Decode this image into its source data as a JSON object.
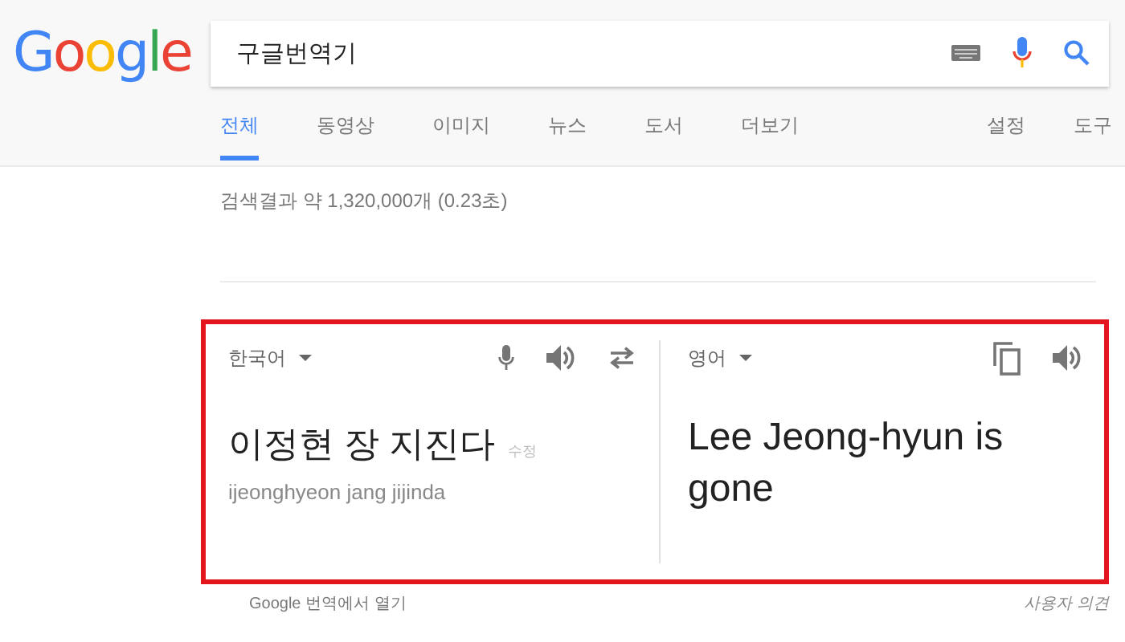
{
  "logo": "Google",
  "search": {
    "value": "구글번역기"
  },
  "tabs": [
    {
      "label": "전체",
      "selected": true
    },
    {
      "label": "동영상",
      "selected": false
    },
    {
      "label": "이미지",
      "selected": false
    },
    {
      "label": "뉴스",
      "selected": false
    },
    {
      "label": "도서",
      "selected": false
    },
    {
      "label": "더보기",
      "selected": false
    }
  ],
  "tools": [
    "설정",
    "도구"
  ],
  "result_stats": "검색결과 약 1,320,000개 (0.23초)",
  "translator": {
    "highlighted": true,
    "source": {
      "language": "한국어",
      "text": "이정현 장 지진다",
      "edit_link": "수정",
      "romanization": "ijeonghyeon jang jijinda"
    },
    "target": {
      "language": "영어",
      "text": "Lee Jeong-hyun is gone"
    }
  },
  "footer": {
    "open_link": "Google 번역에서 열기",
    "feedback": "사용자 의견"
  }
}
